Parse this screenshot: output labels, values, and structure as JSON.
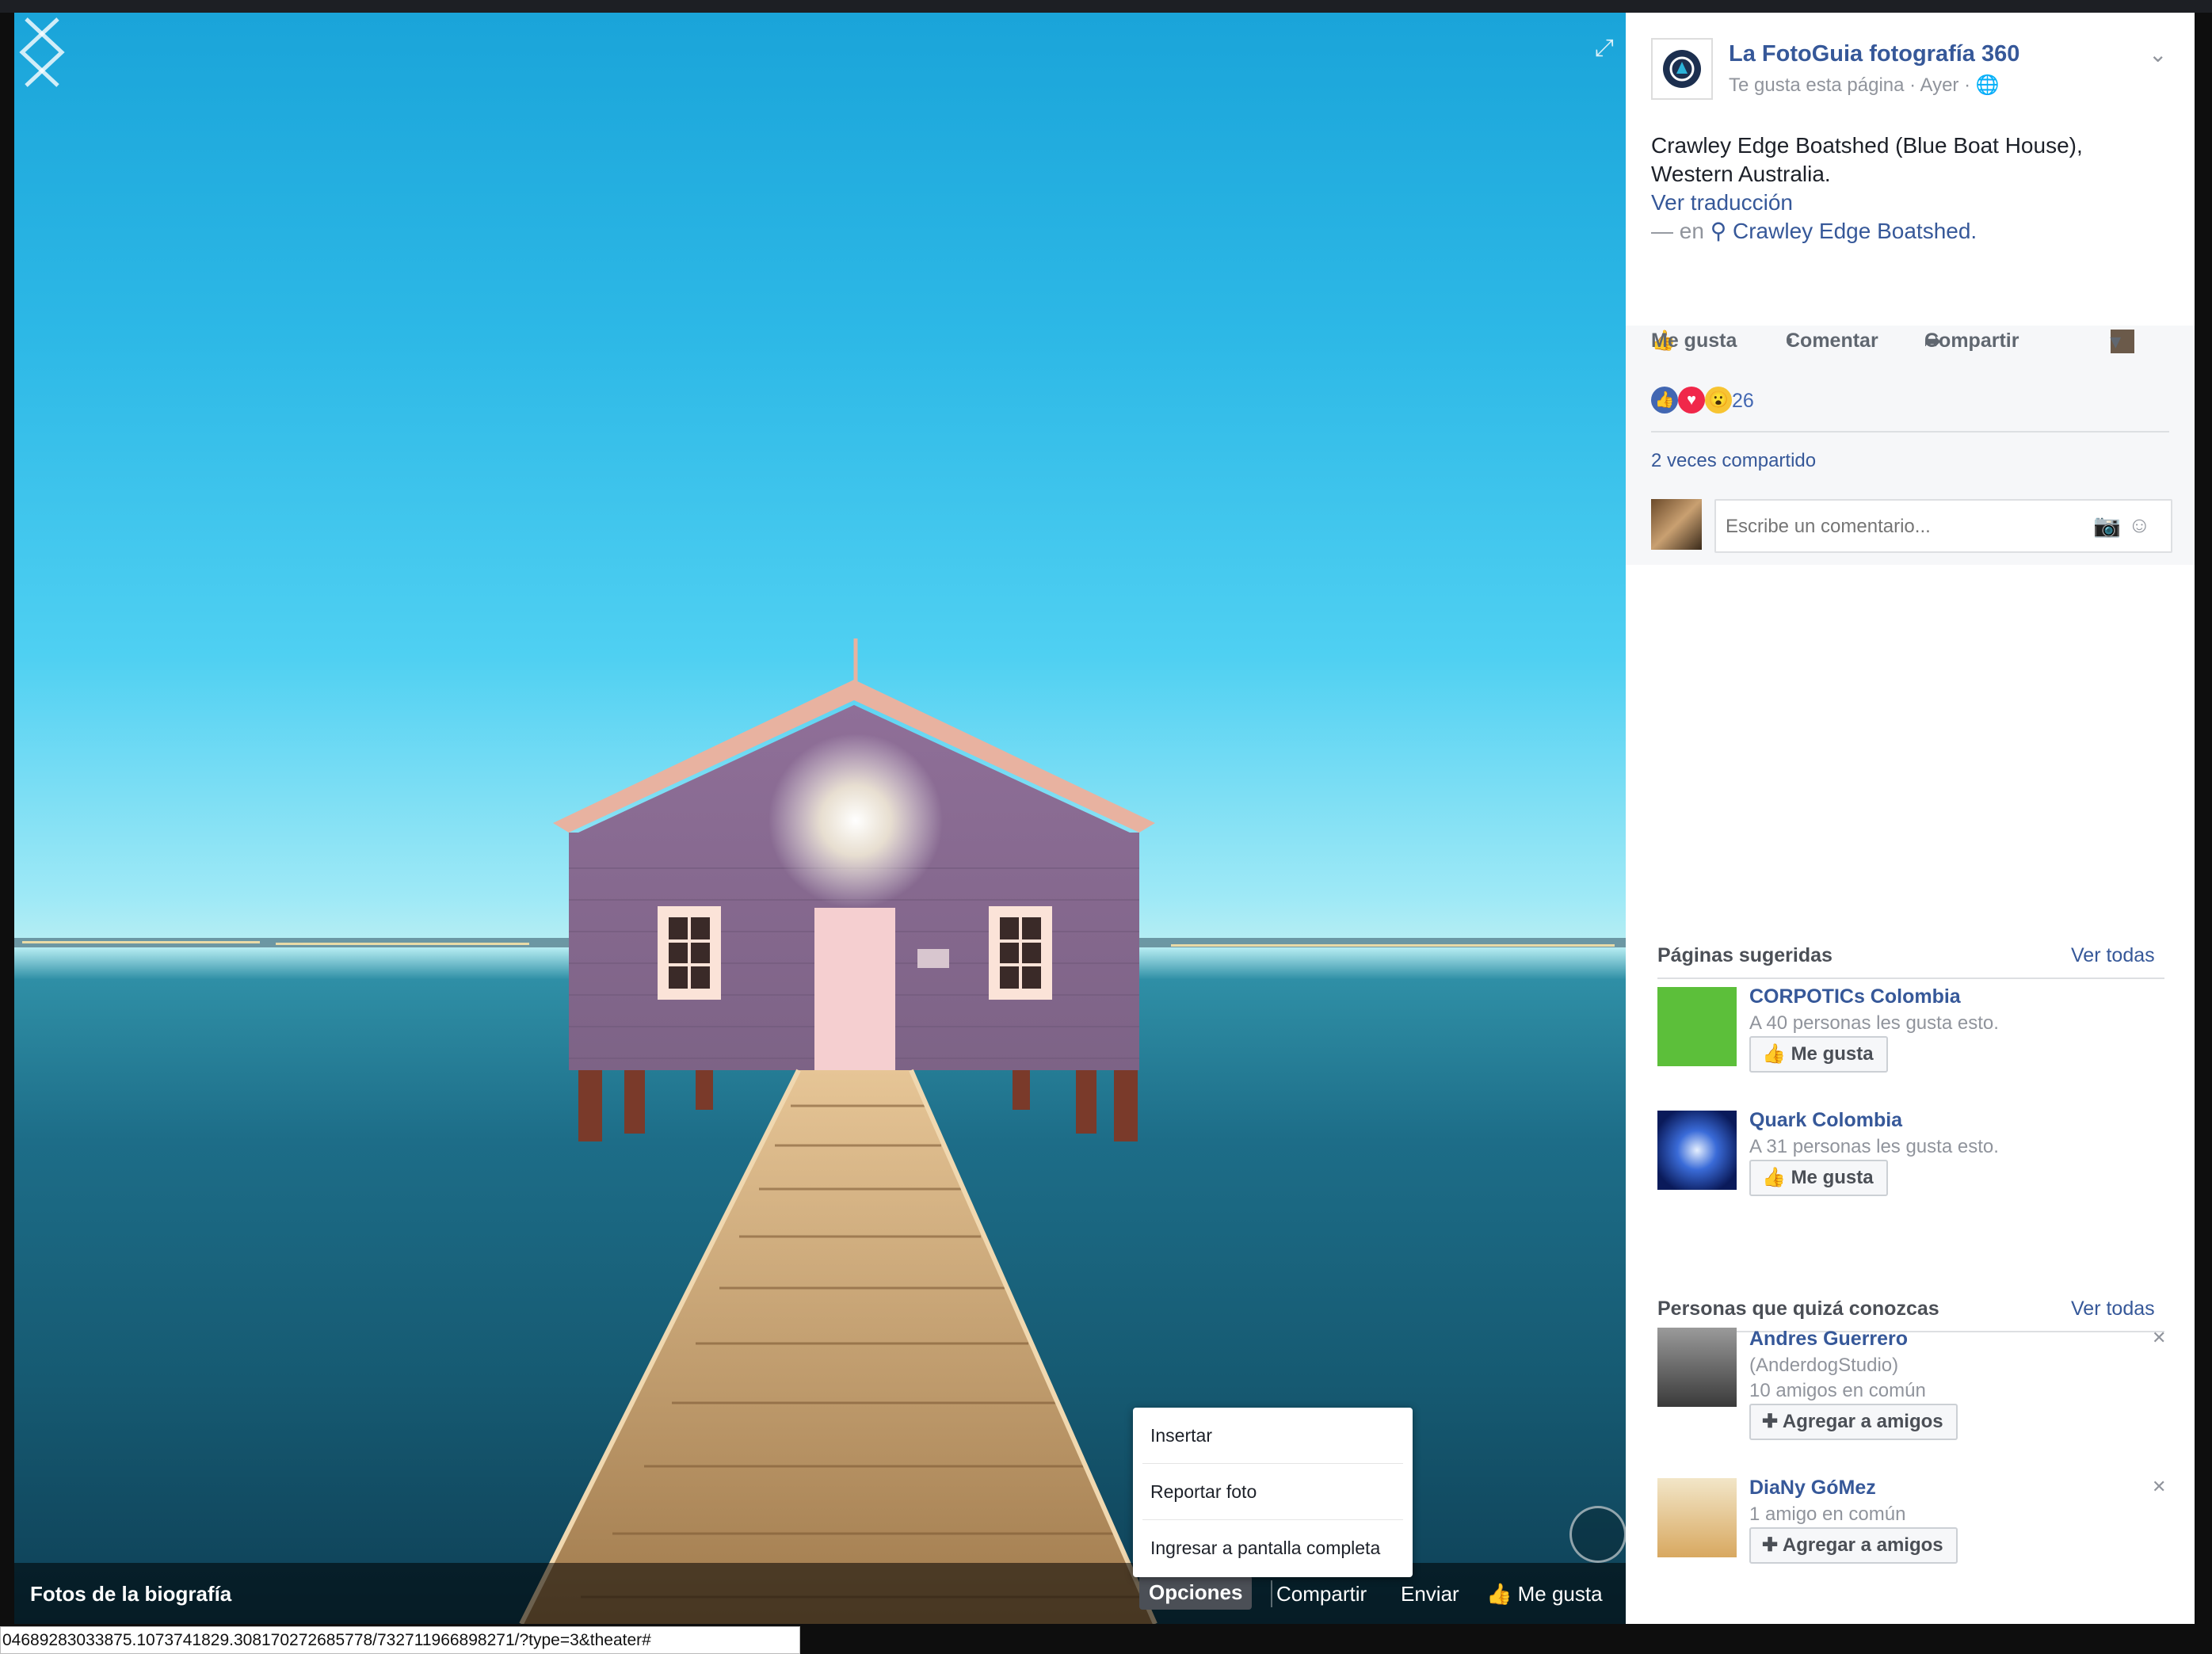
{
  "page": {
    "name": "La FotoGuia fotografía 360",
    "meta": "Te gusta esta página · Ayer ·"
  },
  "post": {
    "text_line1": "Crawley Edge Boatshed (Blue Boat House),",
    "text_line2": "Western Australia.",
    "translate": "Ver traducción",
    "location_prefix": "— en",
    "location": "Crawley Edge Boatshed."
  },
  "actions": {
    "like": "Me gusta",
    "comment": "Comentar",
    "share": "Compartir"
  },
  "reactions": {
    "count": "26"
  },
  "shares": "2 veces compartido",
  "comment": {
    "placeholder": "Escribe un comentario..."
  },
  "photo_bar": {
    "album": "Fotos de la biografía",
    "options": "Opciones",
    "share": "Compartir",
    "send": "Enviar",
    "like": "Me gusta"
  },
  "options_menu": [
    "Insertar",
    "Reportar foto",
    "Ingresar a pantalla completa"
  ],
  "suggested_pages": {
    "title": "Páginas sugeridas",
    "see_all": "Ver todas",
    "items": [
      {
        "name": "CORPOTICs Colombia",
        "meta": "A 40 personas les gusta esto.",
        "button": "Me gusta"
      },
      {
        "name": "Quark Colombia",
        "meta": "A 31 personas les gusta esto.",
        "button": "Me gusta"
      }
    ]
  },
  "people": {
    "title": "Personas que quizá conozcas",
    "see_all": "Ver todas",
    "items": [
      {
        "name": "Andres Guerrero",
        "sub": "(AnderdogStudio)",
        "meta": "10 amigos en común",
        "button": "Agregar a amigos"
      },
      {
        "name": "DiaNy GóMez",
        "meta": "1 amigo en común",
        "button": "Agregar a amigos"
      }
    ]
  },
  "status_url": "04689283033875.1073741829.308170272685778/732711966898271/?type=3&theater#",
  "colors": {
    "link": "#365899",
    "accent": "#4267b2",
    "gray_text": "#90949c"
  }
}
